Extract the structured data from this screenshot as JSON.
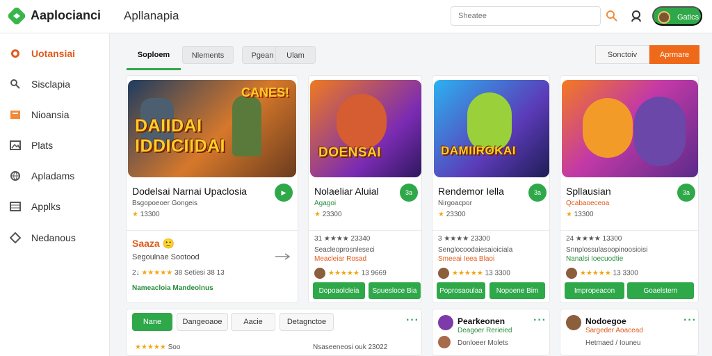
{
  "brand": {
    "logo_text": "Aaplocianci",
    "app_title": "Apllanapia"
  },
  "header": {
    "search_placeholder": "Sheatee",
    "profile_label": "Gatics"
  },
  "sidebar": {
    "items": [
      {
        "label": "Uotansiai",
        "icon": "compass-icon",
        "active": true
      },
      {
        "label": "Sisclapia",
        "icon": "magnifier-icon"
      },
      {
        "label": "Nioansia",
        "icon": "chat-icon"
      },
      {
        "label": "Plats",
        "icon": "image-icon"
      },
      {
        "label": "Apladams",
        "icon": "globe-icon"
      },
      {
        "label": "Applks",
        "icon": "grid-icon"
      },
      {
        "label": "Nedanous",
        "icon": "diamond-icon"
      }
    ]
  },
  "tabs": {
    "items": [
      "Soploem",
      "Nlements",
      "Pgean",
      "Ulam"
    ],
    "sort_label": "Sonctoiv",
    "primary_label": "Aprmare"
  },
  "cards": [
    {
      "hero_text": "DAIIDAI IDDICIIDAI",
      "hero_tag": "CANES!",
      "title": "Dodelsai Narnai Upaclosia",
      "subtitle": "Bsgopoeoer Gongeis",
      "rating": "13300",
      "badge": "",
      "promo": "Saaza",
      "line1": "Segoulnae Sootood",
      "line2": "38 Setiesi 38 13",
      "line3": "Nameacloia Mandeolnus"
    },
    {
      "hero_text": "DOENSAI",
      "hero_tag": "",
      "title": "Nolaeliar Aluial",
      "subtitle": "Agagoi",
      "rating": "23300",
      "badge": "3a",
      "line1": "31 ★★★★ 23340",
      "line2": "Seacleoprosnleseci",
      "line3": "Meacleiar Rosad",
      "review": "13 9669",
      "btn1": "Dopoaolcleia",
      "btn2": "Spuesloce Bia"
    },
    {
      "hero_text": "DAMIIROKAI",
      "hero_tag": "",
      "title": "Rendemor Iella",
      "subtitle": "Nirgoacpor",
      "rating": "23300",
      "badge": "3a",
      "line1": "3 ★★★★ 23300",
      "line2": "Senglocoodaiesaioiciala",
      "line3": "Smeeai Ieea Blaoi",
      "review": "13 3300",
      "btn1": "Poprosaoulaa",
      "btn2": "Nopoene Bim"
    },
    {
      "hero_text": "",
      "hero_tag": "",
      "title": "Spllausian",
      "subtitle": "Qcabaoeceoa",
      "rating": "13300",
      "badge": "3a",
      "line1": "24 ★★★★ 13300",
      "line2": "Snnplossulasoopinoosioisi",
      "line3": "Nanalsi Ioecuodtie",
      "review": "13 3300",
      "btn1": "Impropeacon",
      "btn2": "Goaelstern"
    }
  ],
  "bottom": {
    "pills": [
      "Nane",
      "Dangeoaoe",
      "Aacie",
      "Detagnctoe"
    ],
    "left_text": "Nsaseeneosi ouk 23022",
    "left_rating": "Soo",
    "card2_title": "Pearkeonen",
    "card2_sub1": "Deagoer Rerieied",
    "card2_sub2": "Donloeer Molets",
    "card3_title": "Nodoegoe",
    "card3_sub1": "Sargeder Aoacead",
    "card3_sub2": "Hetmaed / Iouneu"
  },
  "colors": {
    "accent_green": "#2fa84a",
    "accent_orange": "#ee6a1a"
  }
}
